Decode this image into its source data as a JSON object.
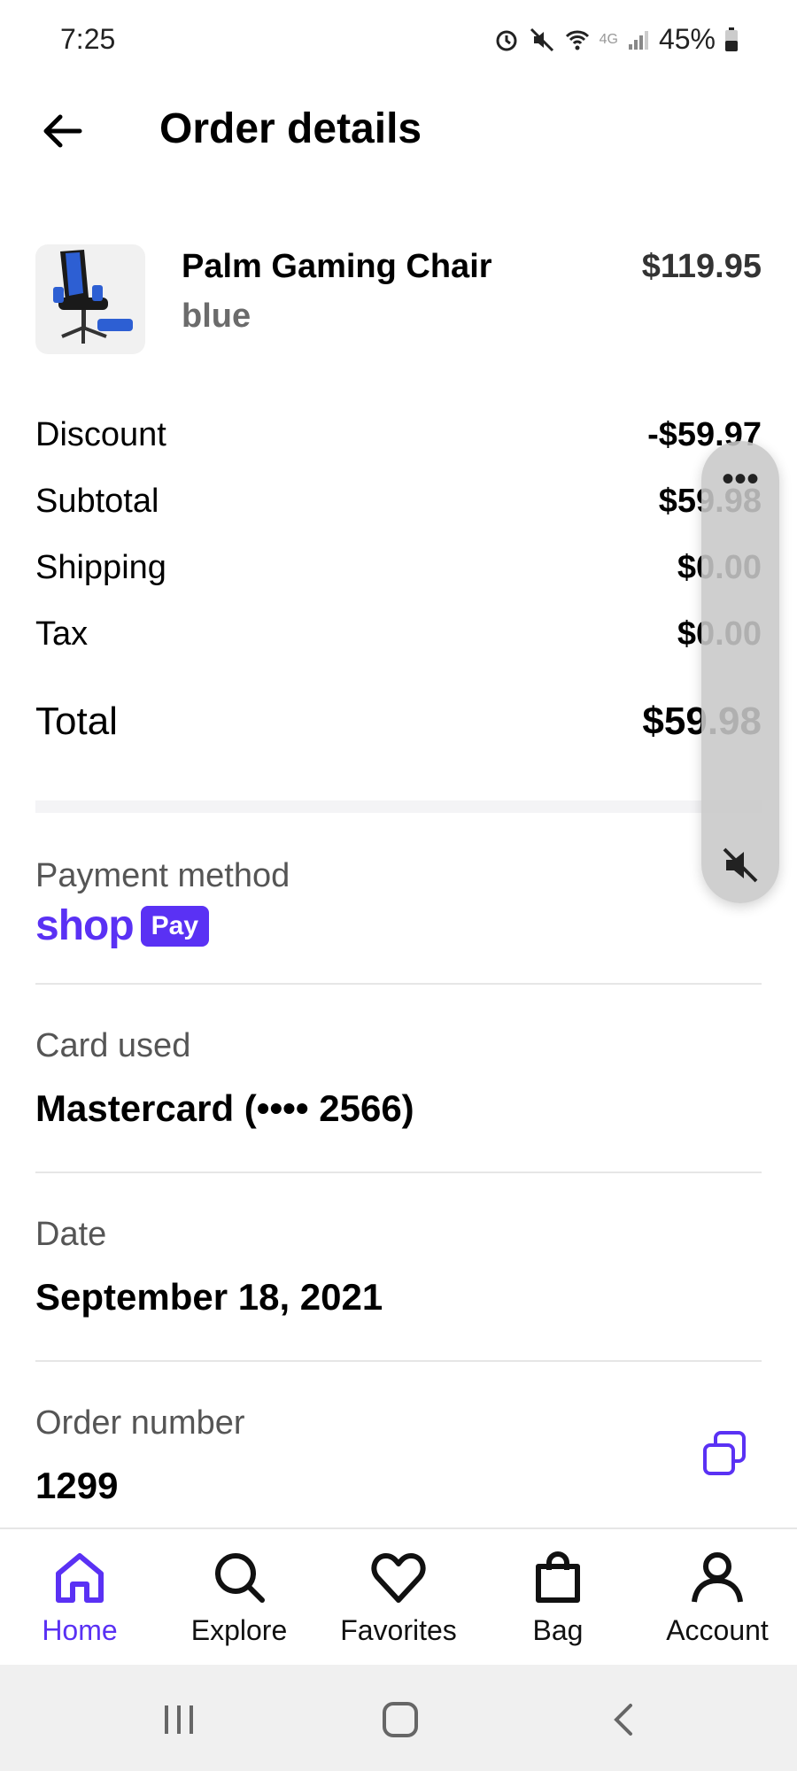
{
  "status": {
    "time": "7:25",
    "network": "4G",
    "battery": "45%"
  },
  "header": {
    "title": "Order details"
  },
  "product": {
    "name": "Palm Gaming Chair",
    "variant": "blue",
    "price": "$119.95"
  },
  "summary": [
    {
      "label": "Discount",
      "value": "-$59.97"
    },
    {
      "label": "Subtotal",
      "value": "$59.98"
    },
    {
      "label": "Shipping",
      "value": "$0.00"
    },
    {
      "label": "Tax",
      "value": "$0.00"
    }
  ],
  "total": {
    "label": "Total",
    "value": "$59.98"
  },
  "payment": {
    "label": "Payment method",
    "brand_word": "shop",
    "brand_badge": "Pay"
  },
  "card": {
    "label": "Card used",
    "value": "Mastercard (•••• 2566)"
  },
  "date": {
    "label": "Date",
    "value": "September 18, 2021"
  },
  "order": {
    "label": "Order number",
    "value": "1299"
  },
  "floating_panel": {
    "more": "•••"
  },
  "nav": [
    {
      "label": "Home",
      "icon": "home-icon",
      "active": true
    },
    {
      "label": "Explore",
      "icon": "search-icon",
      "active": false
    },
    {
      "label": "Favorites",
      "icon": "heart-icon",
      "active": false
    },
    {
      "label": "Bag",
      "icon": "bag-icon",
      "active": false
    },
    {
      "label": "Account",
      "icon": "account-icon",
      "active": false
    }
  ],
  "colors": {
    "accent": "#5a31f4",
    "muted": "#6b6b6b"
  }
}
